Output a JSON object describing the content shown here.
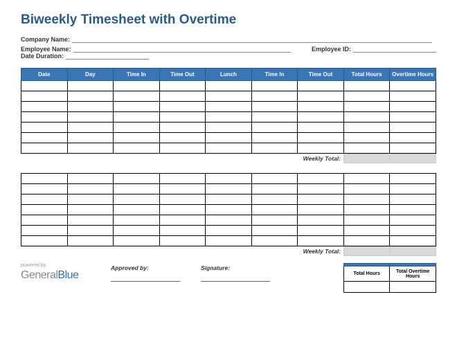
{
  "title": "Biweekly Timesheet with Overtime",
  "fields": {
    "company_label": "Company Name:",
    "company_value": "",
    "employee_label": "Employee Name:",
    "employee_value": "",
    "employee_id_label": "Employee ID:",
    "employee_id_value": "",
    "duration_label": "Date Duration:",
    "duration_value": ""
  },
  "columns": [
    "Date",
    "Day",
    "Time In",
    "Time Out",
    "Lunch",
    "Time In",
    "Time Out",
    "Total Hours",
    "Overtime Hours"
  ],
  "week1_rows": [
    [
      "",
      "",
      "",
      "",
      "",
      "",
      "",
      "",
      ""
    ],
    [
      "",
      "",
      "",
      "",
      "",
      "",
      "",
      "",
      ""
    ],
    [
      "",
      "",
      "",
      "",
      "",
      "",
      "",
      "",
      ""
    ],
    [
      "",
      "",
      "",
      "",
      "",
      "",
      "",
      "",
      ""
    ],
    [
      "",
      "",
      "",
      "",
      "",
      "",
      "",
      "",
      ""
    ],
    [
      "",
      "",
      "",
      "",
      "",
      "",
      "",
      "",
      ""
    ],
    [
      "",
      "",
      "",
      "",
      "",
      "",
      "",
      "",
      ""
    ]
  ],
  "week2_rows": [
    [
      "",
      "",
      "",
      "",
      "",
      "",
      "",
      "",
      ""
    ],
    [
      "",
      "",
      "",
      "",
      "",
      "",
      "",
      "",
      ""
    ],
    [
      "",
      "",
      "",
      "",
      "",
      "",
      "",
      "",
      ""
    ],
    [
      "",
      "",
      "",
      "",
      "",
      "",
      "",
      "",
      ""
    ],
    [
      "",
      "",
      "",
      "",
      "",
      "",
      "",
      "",
      ""
    ],
    [
      "",
      "",
      "",
      "",
      "",
      "",
      "",
      "",
      ""
    ],
    [
      "",
      "",
      "",
      "",
      "",
      "",
      "",
      "",
      ""
    ]
  ],
  "weekly_total_label": "Weekly Total:",
  "weekly_total_1_hours": "",
  "weekly_total_1_ot": "",
  "weekly_total_2_hours": "",
  "weekly_total_2_ot": "",
  "footer": {
    "powered_by": "powered by",
    "brand_a": "General",
    "brand_b": "Blue",
    "approved_label": "Approved by:",
    "approved_value": "",
    "signature_label": "Signature:",
    "signature_value": ""
  },
  "totals": {
    "col1_label": "Total Hours",
    "col2_label": "Total Overtime Hours",
    "col1_value": "",
    "col2_value": ""
  }
}
